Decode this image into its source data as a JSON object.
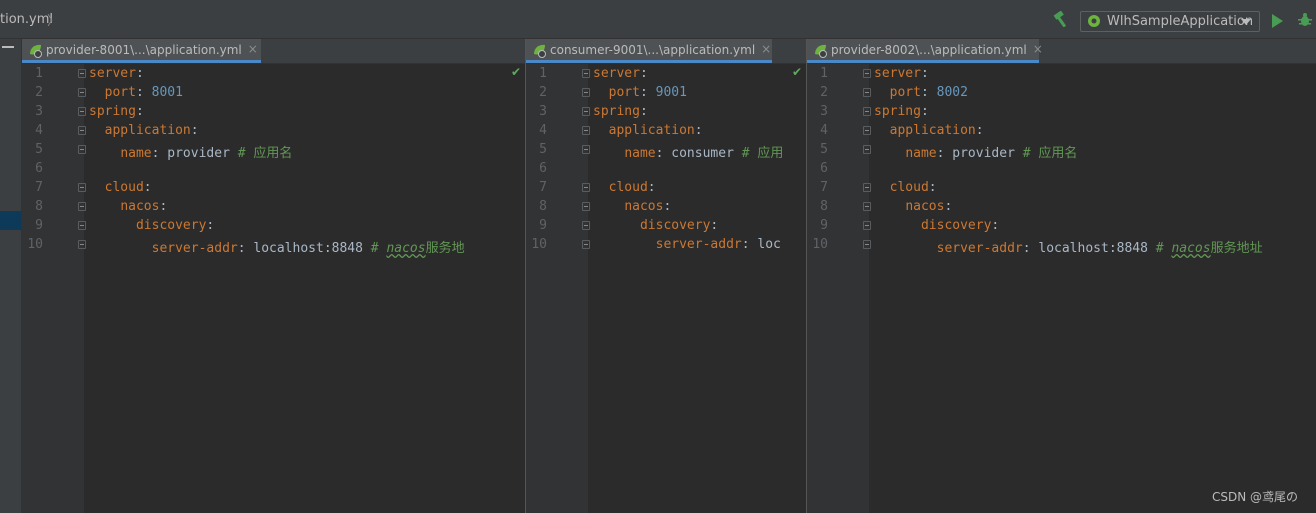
{
  "breadcrumb": {
    "file": "tion.yml",
    "separator": "〉"
  },
  "toolbar": {
    "run_config_label": "WlhSampleApplication"
  },
  "panes": [
    {
      "tab_label": "provider-8001\\...\\application.yml",
      "tab_close": "×",
      "lines": [
        {
          "num": "1",
          "key": "server",
          "sep": ":",
          "val": "",
          "valtype": "",
          "comment": "",
          "comment_it": "",
          "comment_tail": "",
          "indent": ""
        },
        {
          "num": "2",
          "key": "port",
          "sep": ":",
          "val": "8001",
          "valtype": "n",
          "comment": "",
          "comment_it": "",
          "comment_tail": "",
          "indent": "  "
        },
        {
          "num": "3",
          "key": "spring",
          "sep": ":",
          "val": "",
          "valtype": "",
          "comment": "",
          "comment_it": "",
          "comment_tail": "",
          "indent": ""
        },
        {
          "num": "4",
          "key": "application",
          "sep": ":",
          "val": "",
          "valtype": "",
          "comment": "",
          "comment_it": "",
          "comment_tail": "",
          "indent": "  "
        },
        {
          "num": "5",
          "key": "name",
          "sep": ":",
          "val": "provider",
          "valtype": "s",
          "comment": "# 应用名",
          "comment_it": "",
          "comment_tail": "",
          "indent": "    "
        },
        {
          "num": "6",
          "key": "",
          "sep": "",
          "val": "",
          "valtype": "",
          "comment": "",
          "comment_it": "",
          "comment_tail": "",
          "indent": ""
        },
        {
          "num": "7",
          "key": "cloud",
          "sep": ":",
          "val": "",
          "valtype": "",
          "comment": "",
          "comment_it": "",
          "comment_tail": "",
          "indent": "  "
        },
        {
          "num": "8",
          "key": "nacos",
          "sep": ":",
          "val": "",
          "valtype": "",
          "comment": "",
          "comment_it": "",
          "comment_tail": "",
          "indent": "    "
        },
        {
          "num": "9",
          "key": "discovery",
          "sep": ":",
          "val": "",
          "valtype": "",
          "comment": "",
          "comment_it": "",
          "comment_tail": "",
          "indent": "      "
        },
        {
          "num": "10",
          "key": "server-addr",
          "sep": ":",
          "val": "localhost:8848",
          "valtype": "s",
          "comment": "#",
          "comment_it": "nacos",
          "comment_tail": "服务地",
          "indent": "        "
        }
      ]
    },
    {
      "tab_label": "consumer-9001\\...\\application.yml",
      "tab_close": "×",
      "lines": [
        {
          "num": "1",
          "key": "server",
          "sep": ":",
          "val": "",
          "valtype": "",
          "comment": "",
          "comment_it": "",
          "comment_tail": "",
          "indent": ""
        },
        {
          "num": "2",
          "key": "port",
          "sep": ":",
          "val": "9001",
          "valtype": "n",
          "comment": "",
          "comment_it": "",
          "comment_tail": "",
          "indent": "  "
        },
        {
          "num": "3",
          "key": "spring",
          "sep": ":",
          "val": "",
          "valtype": "",
          "comment": "",
          "comment_it": "",
          "comment_tail": "",
          "indent": ""
        },
        {
          "num": "4",
          "key": "application",
          "sep": ":",
          "val": "",
          "valtype": "",
          "comment": "",
          "comment_it": "",
          "comment_tail": "",
          "indent": "  "
        },
        {
          "num": "5",
          "key": "name",
          "sep": ":",
          "val": "consumer",
          "valtype": "s",
          "comment": "# 应用",
          "comment_it": "",
          "comment_tail": "",
          "indent": "    "
        },
        {
          "num": "6",
          "key": "",
          "sep": "",
          "val": "",
          "valtype": "",
          "comment": "",
          "comment_it": "",
          "comment_tail": "",
          "indent": ""
        },
        {
          "num": "7",
          "key": "cloud",
          "sep": ":",
          "val": "",
          "valtype": "",
          "comment": "",
          "comment_it": "",
          "comment_tail": "",
          "indent": "  "
        },
        {
          "num": "8",
          "key": "nacos",
          "sep": ":",
          "val": "",
          "valtype": "",
          "comment": "",
          "comment_it": "",
          "comment_tail": "",
          "indent": "    "
        },
        {
          "num": "9",
          "key": "discovery",
          "sep": ":",
          "val": "",
          "valtype": "",
          "comment": "",
          "comment_it": "",
          "comment_tail": "",
          "indent": "      "
        },
        {
          "num": "10",
          "key": "server-addr",
          "sep": ":",
          "val": "loc",
          "valtype": "s",
          "comment": "",
          "comment_it": "",
          "comment_tail": "",
          "indent": "        "
        }
      ]
    },
    {
      "tab_label": "provider-8002\\...\\application.yml",
      "tab_close": "×",
      "lines": [
        {
          "num": "1",
          "key": "server",
          "sep": ":",
          "val": "",
          "valtype": "",
          "comment": "",
          "comment_it": "",
          "comment_tail": "",
          "indent": ""
        },
        {
          "num": "2",
          "key": "port",
          "sep": ":",
          "val": "8002",
          "valtype": "n",
          "comment": "",
          "comment_it": "",
          "comment_tail": "",
          "indent": "  "
        },
        {
          "num": "3",
          "key": "spring",
          "sep": ":",
          "val": "",
          "valtype": "",
          "comment": "",
          "comment_it": "",
          "comment_tail": "",
          "indent": ""
        },
        {
          "num": "4",
          "key": "application",
          "sep": ":",
          "val": "",
          "valtype": "",
          "comment": "",
          "comment_it": "",
          "comment_tail": "",
          "indent": "  "
        },
        {
          "num": "5",
          "key": "name",
          "sep": ":",
          "val": "provider",
          "valtype": "s",
          "comment": "# 应用名",
          "comment_it": "",
          "comment_tail": "",
          "indent": "    "
        },
        {
          "num": "6",
          "key": "",
          "sep": "",
          "val": "",
          "valtype": "",
          "comment": "",
          "comment_it": "",
          "comment_tail": "",
          "indent": ""
        },
        {
          "num": "7",
          "key": "cloud",
          "sep": ":",
          "val": "",
          "valtype": "",
          "comment": "",
          "comment_it": "",
          "comment_tail": "",
          "indent": "  "
        },
        {
          "num": "8",
          "key": "nacos",
          "sep": ":",
          "val": "",
          "valtype": "",
          "comment": "",
          "comment_it": "",
          "comment_tail": "",
          "indent": "    "
        },
        {
          "num": "9",
          "key": "discovery",
          "sep": ":",
          "val": "",
          "valtype": "",
          "comment": "",
          "comment_it": "",
          "comment_tail": "",
          "indent": "      "
        },
        {
          "num": "10",
          "key": "server-addr",
          "sep": ":",
          "val": "localhost:8848",
          "valtype": "s",
          "comment": "#",
          "comment_it": "nacos",
          "comment_tail": "服务地址",
          "indent": "        "
        }
      ]
    }
  ],
  "inspection_ok_icon": "✔",
  "watermark": "CSDN @鸢尾の",
  "colors": {
    "key": "#cc7832",
    "number": "#6897bb",
    "comment": "#629755",
    "text": "#a9b7c6",
    "tab_underline": "#4a88c7",
    "run_green": "#499c54"
  }
}
